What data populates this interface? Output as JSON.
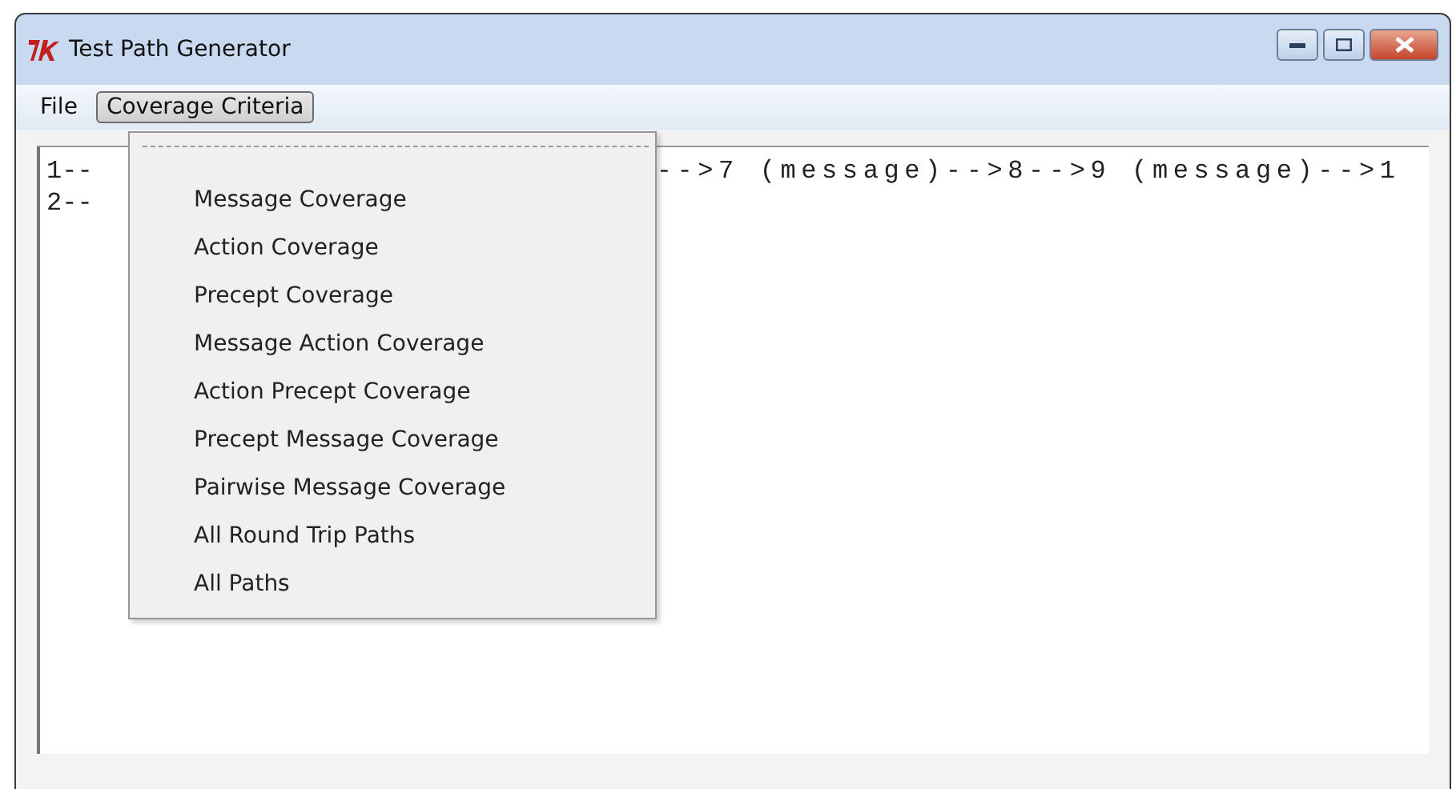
{
  "window": {
    "title": "Test Path Generator"
  },
  "menu_bar": [
    {
      "label": "File",
      "selected": false
    },
    {
      "label": "Coverage Criteria",
      "selected": true
    }
  ],
  "text_area": {
    "lines": [
      {
        "left": "1--",
        "right": "-->7 (message)-->8-->9 (message)-->1"
      },
      {
        "left": "2--"
      }
    ]
  },
  "dropdown": {
    "tear_off": true,
    "items": [
      "Message Coverage",
      "Action Coverage",
      "Precept Coverage",
      "Message Action Coverage",
      "Action Precept Coverage",
      "Precept Message Coverage",
      "Pairwise Message Coverage",
      "All Round Trip Paths",
      "All Paths"
    ]
  }
}
